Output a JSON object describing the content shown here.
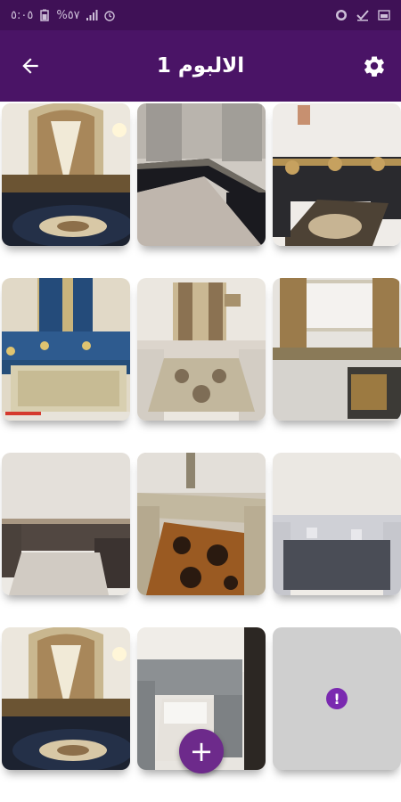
{
  "status_bar": {
    "time": "٥:٠٥",
    "battery": "%٥٧",
    "icons": [
      "battery-icon",
      "signal-icon",
      "alarm-icon",
      "whatsapp-icon",
      "check-icon",
      "gallery-icon"
    ]
  },
  "app_bar": {
    "title": "الالبوم 1",
    "back_icon": "arrow-back-icon",
    "settings_icon": "gear-icon"
  },
  "theme": {
    "primary": "#4a1466",
    "status": "#3f1156",
    "accent": "#6d2a8b"
  },
  "gallery": {
    "photos": [
      {
        "name": "photo-majlis-curtain-arch"
      },
      {
        "name": "photo-majlis-black-floor"
      },
      {
        "name": "photo-majlis-black-gold"
      },
      {
        "name": "photo-majlis-blue"
      },
      {
        "name": "photo-majlis-white"
      },
      {
        "name": "photo-majlis-window"
      },
      {
        "name": "photo-majlis-grey-brown"
      },
      {
        "name": "photo-majlis-brown-rug"
      },
      {
        "name": "photo-majlis-grey-empty"
      },
      {
        "name": "photo-majlis-curtain-arch-2"
      },
      {
        "name": "photo-majlis-grey-corner"
      },
      {
        "name": "photo-placeholder-error"
      }
    ],
    "error_icon": "alert-icon"
  },
  "fab": {
    "label": "+",
    "icon": "add-icon"
  }
}
